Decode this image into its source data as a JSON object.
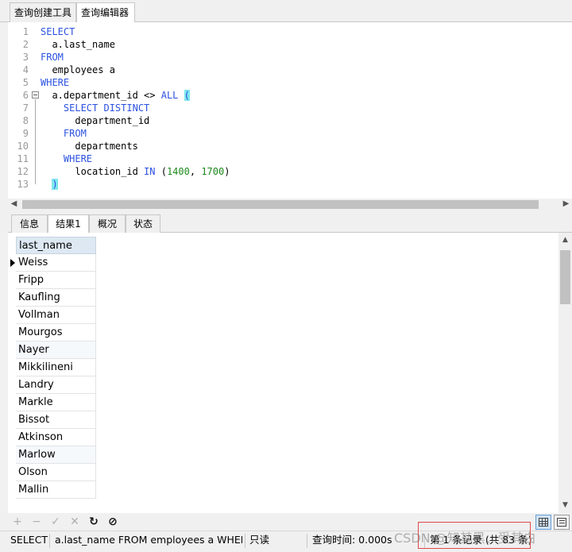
{
  "top_tabs": [
    "查询创建工具",
    "查询编辑器"
  ],
  "editor": {
    "lines": [
      {
        "n": "1",
        "parts": [
          {
            "t": "SELECT",
            "c": "kw"
          }
        ]
      },
      {
        "n": "2",
        "parts": [
          {
            "t": "  a.last_name",
            "c": ""
          }
        ]
      },
      {
        "n": "3",
        "parts": [
          {
            "t": "FROM",
            "c": "kw"
          }
        ]
      },
      {
        "n": "4",
        "parts": [
          {
            "t": "  employees a",
            "c": ""
          }
        ]
      },
      {
        "n": "5",
        "parts": [
          {
            "t": "WHERE",
            "c": "kw"
          }
        ]
      },
      {
        "n": "6",
        "parts": [
          {
            "t": "  a.department_id <> ",
            "c": ""
          },
          {
            "t": "ALL",
            "c": "kw"
          },
          {
            "t": " ",
            "c": ""
          },
          {
            "t": "(",
            "c": "hl"
          }
        ]
      },
      {
        "n": "7",
        "parts": [
          {
            "t": "    ",
            "c": ""
          },
          {
            "t": "SELECT DISTINCT",
            "c": "kw"
          }
        ]
      },
      {
        "n": "8",
        "parts": [
          {
            "t": "      department_id",
            "c": ""
          }
        ]
      },
      {
        "n": "9",
        "parts": [
          {
            "t": "    ",
            "c": ""
          },
          {
            "t": "FROM",
            "c": "kw"
          }
        ]
      },
      {
        "n": "10",
        "parts": [
          {
            "t": "      departments",
            "c": ""
          }
        ]
      },
      {
        "n": "11",
        "parts": [
          {
            "t": "    ",
            "c": ""
          },
          {
            "t": "WHERE",
            "c": "kw"
          }
        ]
      },
      {
        "n": "12",
        "parts": [
          {
            "t": "      location_id ",
            "c": ""
          },
          {
            "t": "IN",
            "c": "kw"
          },
          {
            "t": " (",
            "c": ""
          },
          {
            "t": "1400",
            "c": "num"
          },
          {
            "t": ", ",
            "c": ""
          },
          {
            "t": "1700",
            "c": "num"
          },
          {
            "t": ")",
            "c": ""
          }
        ]
      },
      {
        "n": "13",
        "parts": [
          {
            "t": "  ",
            "c": ""
          },
          {
            "t": ")",
            "c": "hl"
          }
        ]
      }
    ]
  },
  "result_tabs": [
    "信息",
    "结果1",
    "概况",
    "状态"
  ],
  "grid": {
    "column": "last_name",
    "rows": [
      "Weiss",
      "Fripp",
      "Kaufling",
      "Vollman",
      "Mourgos",
      "Nayer",
      "Mikkilineni",
      "Landry",
      "Markle",
      "Bissot",
      "Atkinson",
      "Marlow",
      "Olson",
      "Mallin"
    ]
  },
  "toolbar": {
    "add": "+",
    "remove": "−",
    "apply": "✓",
    "discard": "✕",
    "refresh": "↻",
    "stop": "⊘"
  },
  "status": {
    "query_type": "SELECT",
    "query_text": "a.last_name FROM employees a WHERE",
    "mode": "只读",
    "query_time": "查询时间: 0.000s",
    "records": "第 1 条记录 (共 83 条)"
  },
  "watermark": "CSDN @知其黑、受其白",
  "icons": {
    "row_pointer": "triangle-right-icon",
    "grid_view": "grid-view-icon",
    "form_view": "form-view-icon"
  }
}
